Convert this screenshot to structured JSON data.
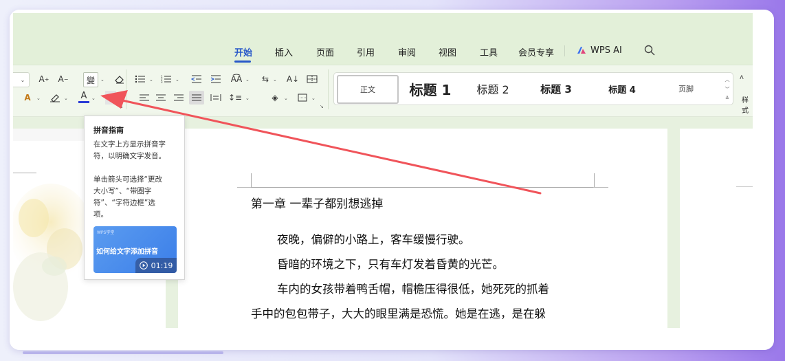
{
  "tabs": [
    {
      "label": "开始",
      "active": true
    },
    {
      "label": "插入"
    },
    {
      "label": "页面"
    },
    {
      "label": "引用"
    },
    {
      "label": "审阅"
    },
    {
      "label": "视图"
    },
    {
      "label": "工具"
    },
    {
      "label": "会员专享"
    },
    {
      "label": "WPS AI"
    }
  ],
  "styles": {
    "normal": "正文",
    "h1": "标题 1",
    "h2": "标题 2",
    "h3": "标题 3",
    "h4": "标题 4",
    "footer": "页脚",
    "pane_label": "样式"
  },
  "tooltip": {
    "title": "拼音指南",
    "line1": "在文字上方显示拼音字",
    "line2": "符，以明确文字发音。",
    "line3": "单击箭头可选择“更改",
    "line4": "大小写”、“带圈字",
    "line5": "符”、“字符边框”选",
    "line6": "项。",
    "video_brand": "WPS学堂",
    "video_title": "如何给文字添加拼音",
    "video_time": "01:19"
  },
  "document": {
    "chapter": "第一章  一辈子都别想逃掉",
    "paragraphs": [
      "夜晚，偏僻的小路上，客车缓慢行驶。",
      "昏暗的环境之下，只有车灯发着昏黄的光芒。",
      "车内的女孩带着鸭舌帽，帽檐压得很低，她死死的抓着",
      "手中的包包带子，大大的眼里满是恐慌。她是在逃，是在躲"
    ]
  },
  "colors": {
    "accent": "#2757c9",
    "arrow": "#f0545a",
    "ribbon_bg": "#f1f7ec",
    "header_bg": "#e3f0d9"
  }
}
